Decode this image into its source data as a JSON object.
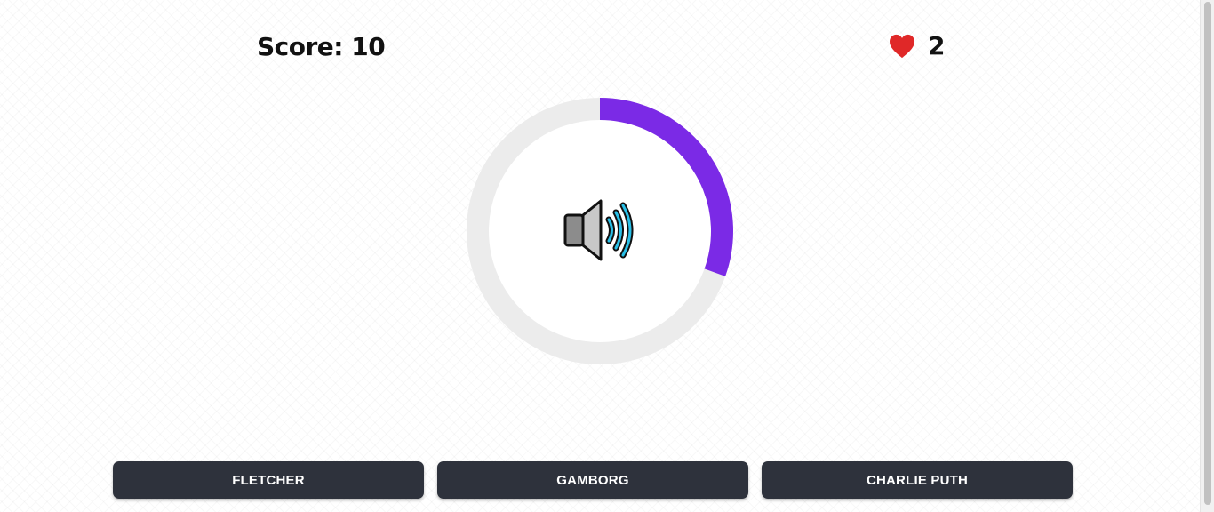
{
  "header": {
    "score_text": "Score: 10",
    "lives_count": "2",
    "lives_icon": "heart-icon"
  },
  "timer": {
    "remaining_fraction": 0.305,
    "progress_color": "#7b2ae6",
    "track_color": "#ececec",
    "center_icon": "speaker-icon"
  },
  "colors": {
    "heart": "#e02828",
    "button_bg": "#2e323c",
    "button_text": "#ffffff",
    "speaker_waves": "#29c0e8"
  },
  "answers": [
    {
      "label": "FLETCHER"
    },
    {
      "label": "GAMBORG"
    },
    {
      "label": "CHARLIE PUTH"
    }
  ]
}
